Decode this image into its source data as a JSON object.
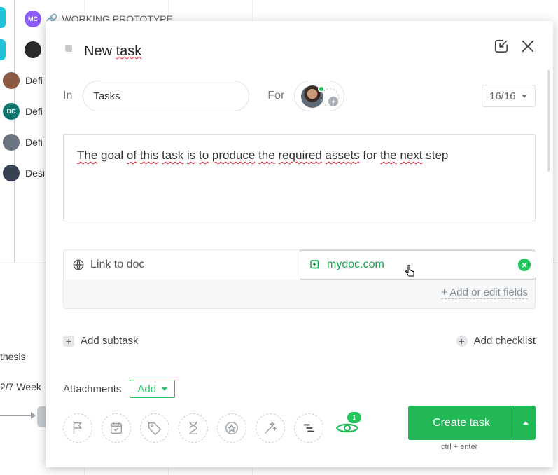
{
  "background": {
    "project_label": "WORKING PROTOTYPE",
    "project_avatar": "MC",
    "rows": [
      {
        "avatar": "",
        "label": "Defi",
        "color": "#8a5a44"
      },
      {
        "avatar": "DC",
        "label": "Defi",
        "color": "#0f766e"
      },
      {
        "avatar": "",
        "label": "Defi",
        "color": "#6b7280"
      },
      {
        "avatar": "",
        "label": "Desi",
        "color": "#374151"
      }
    ],
    "left_text_1": "thesis",
    "left_text_2": "2/7 Week"
  },
  "modal": {
    "title": "New task",
    "in_label": "In",
    "project": "Tasks",
    "for_label": "For",
    "counter": "16/16",
    "description_words": [
      "The",
      "goal",
      "of",
      "this",
      "task",
      "is",
      "to",
      "produce",
      "the",
      "required",
      "assets",
      "for",
      "the",
      "next",
      "step"
    ],
    "custom_field": {
      "label": "Link to doc",
      "value": "mydoc.com"
    },
    "add_fields_link": "+ Add or edit fields",
    "add_subtask": "Add subtask",
    "add_checklist": "Add checklist",
    "attachments_label": "Attachments",
    "attachments_add": "Add",
    "watchers_count": "1",
    "create_button": "Create task",
    "shortcut_hint": "ctrl + enter"
  },
  "colors": {
    "accent": "#22b855",
    "cyan": "#21c2d8"
  },
  "icons": {
    "tools": [
      "flag-icon",
      "calendar-check-icon",
      "tag-icon",
      "hourglass-icon",
      "star-icon",
      "magic-wand-icon",
      "gantt-icon"
    ]
  }
}
